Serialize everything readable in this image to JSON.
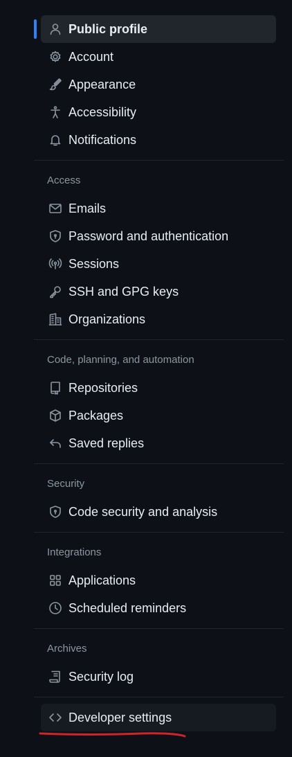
{
  "groups": [
    {
      "heading": "",
      "items": [
        {
          "label": "Public profile",
          "icon": "person-icon",
          "active": true
        },
        {
          "label": "Account",
          "icon": "gear-icon"
        },
        {
          "label": "Appearance",
          "icon": "paintbrush-icon"
        },
        {
          "label": "Accessibility",
          "icon": "accessibility-icon"
        },
        {
          "label": "Notifications",
          "icon": "bell-icon"
        }
      ]
    },
    {
      "heading": "Access",
      "items": [
        {
          "label": "Emails",
          "icon": "mail-icon"
        },
        {
          "label": "Password and authentication",
          "icon": "shield-lock-icon"
        },
        {
          "label": "Sessions",
          "icon": "broadcast-icon"
        },
        {
          "label": "SSH and GPG keys",
          "icon": "key-icon"
        },
        {
          "label": "Organizations",
          "icon": "organization-icon"
        }
      ]
    },
    {
      "heading": "Code, planning, and automation",
      "items": [
        {
          "label": "Repositories",
          "icon": "repo-icon"
        },
        {
          "label": "Packages",
          "icon": "package-icon"
        },
        {
          "label": "Saved replies",
          "icon": "reply-icon"
        }
      ]
    },
    {
      "heading": "Security",
      "items": [
        {
          "label": "Code security and analysis",
          "icon": "shield-icon"
        }
      ]
    },
    {
      "heading": "Integrations",
      "items": [
        {
          "label": "Applications",
          "icon": "apps-icon"
        },
        {
          "label": "Scheduled reminders",
          "icon": "clock-icon"
        }
      ]
    },
    {
      "heading": "Archives",
      "items": [
        {
          "label": "Security log",
          "icon": "log-icon"
        }
      ]
    }
  ],
  "developer": {
    "label": "Developer settings",
    "icon": "code-icon"
  },
  "colors": {
    "accent": "#2f81f7",
    "annotation": "#d1232a",
    "background": "#0d1117"
  }
}
